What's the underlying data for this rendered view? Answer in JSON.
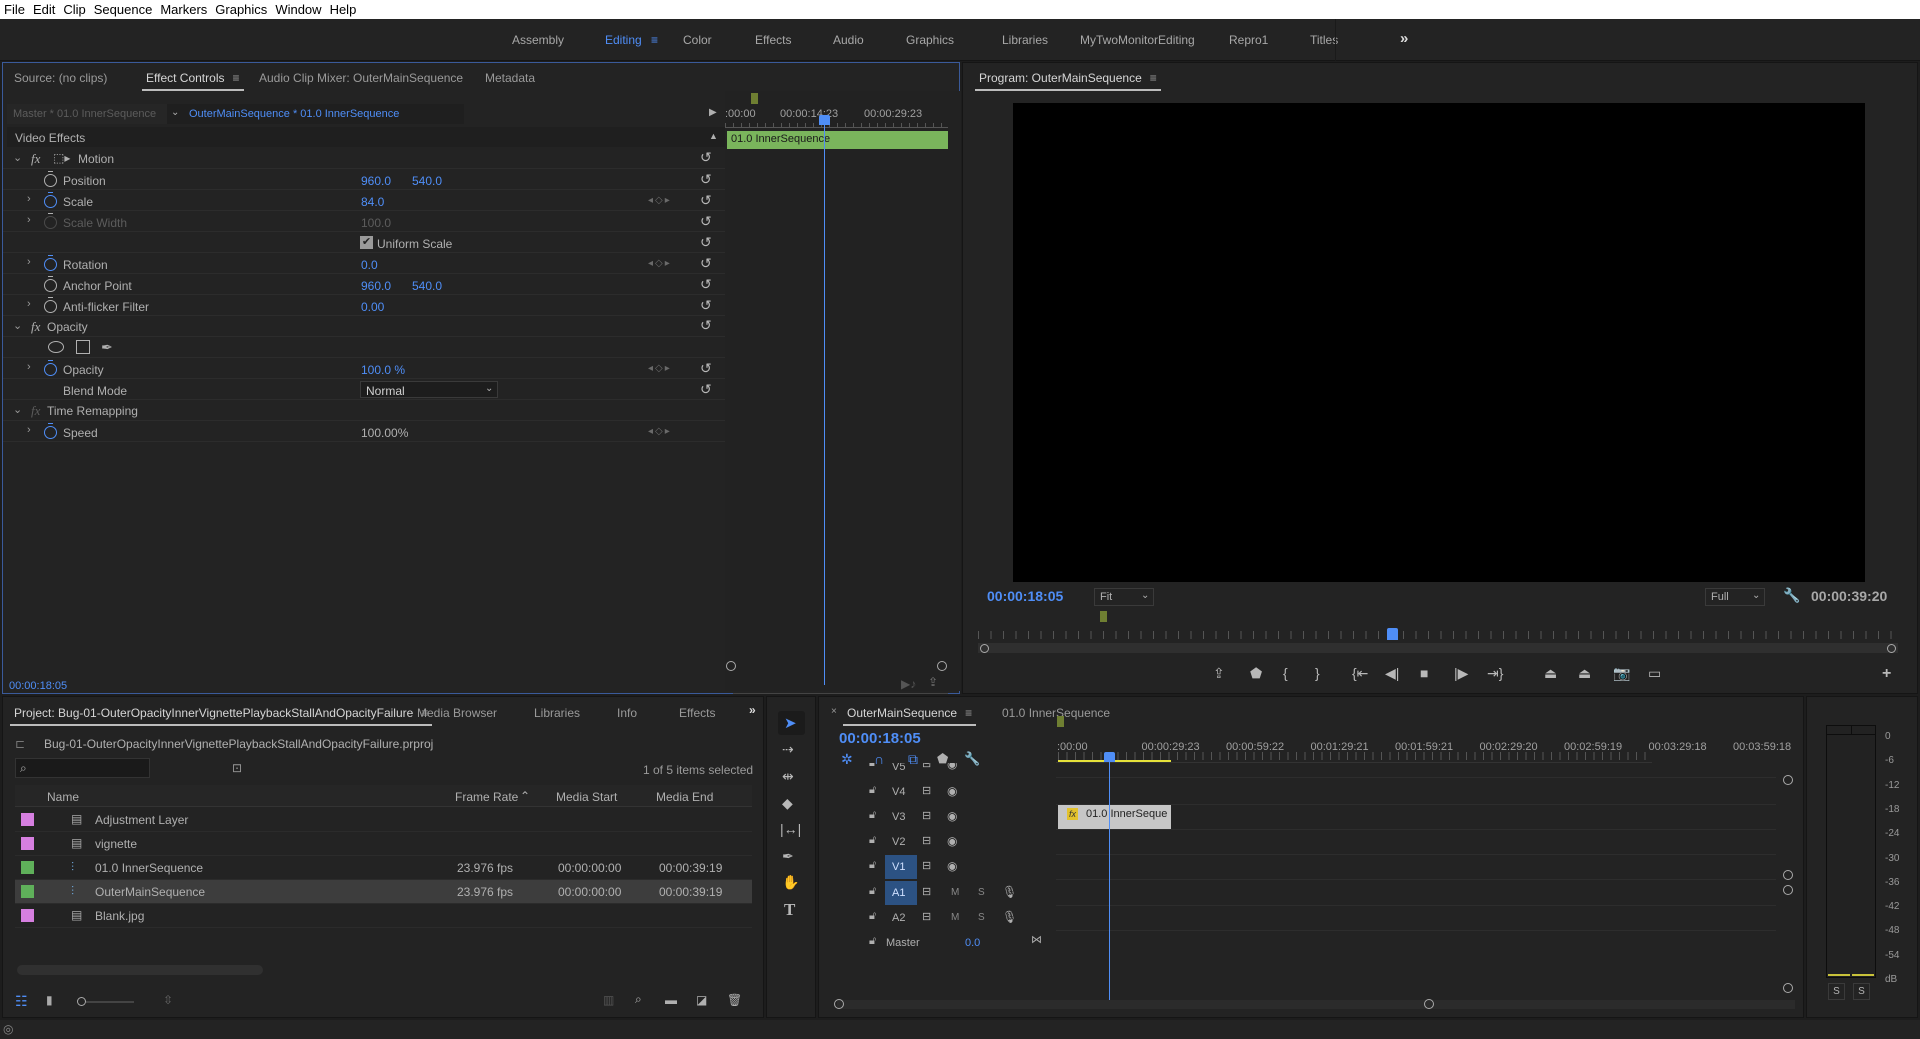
{
  "menu": [
    "File",
    "Edit",
    "Clip",
    "Sequence",
    "Markers",
    "Graphics",
    "Window",
    "Help"
  ],
  "workspaces": {
    "items": [
      "Assembly",
      "Editing",
      "Color",
      "Effects",
      "Audio",
      "Graphics",
      "Libraries",
      "MyTwoMonitorEditing",
      "Repro1",
      "Titles"
    ],
    "active": "Editing",
    "overflow": "»"
  },
  "source_panel": {
    "tabs": [
      "Source: (no clips)",
      "Effect Controls",
      "Audio Clip Mixer: OuterMainSequence",
      "Metadata"
    ],
    "active_tab": "Effect Controls",
    "master_label": "Master * 01.0 InnerSequence",
    "sequence_label": "OuterMainSequence * 01.0 InnerSequence",
    "section_title": "Video Effects",
    "motion": {
      "title": "Motion",
      "position": {
        "label": "Position",
        "x": "960.0",
        "y": "540.0"
      },
      "scale": {
        "label": "Scale",
        "value": "84.0"
      },
      "scale_width": {
        "label": "Scale Width",
        "value": "100.0"
      },
      "uniform_scale": {
        "label": "Uniform Scale",
        "checked": true
      },
      "rotation": {
        "label": "Rotation",
        "value": "0.0"
      },
      "anchor_point": {
        "label": "Anchor Point",
        "x": "960.0",
        "y": "540.0"
      },
      "anti_flicker": {
        "label": "Anti-flicker Filter",
        "value": "0.00"
      }
    },
    "opacity": {
      "title": "Opacity",
      "opacity": {
        "label": "Opacity",
        "value": "100.0 %"
      },
      "blend_mode": {
        "label": "Blend Mode",
        "value": "Normal"
      }
    },
    "time_remapping": {
      "title": "Time Remapping",
      "speed": {
        "label": "Speed",
        "value": "100.00%"
      }
    },
    "mini_timeline": {
      "ticks": [
        ":00:00",
        "00:00:14:23",
        "00:00:29:23"
      ],
      "clip_label": "01.0 InnerSequence"
    },
    "timecode": "00:00:18:05"
  },
  "program_monitor": {
    "title": "Program: OuterMainSequence",
    "timecode": "00:00:18:05",
    "zoom": "Fit",
    "resolution": "Full",
    "duration": "00:00:39:20",
    "playhead_fraction": 0.45
  },
  "project_panel": {
    "tabs": [
      "Project: Bug-01-OuterOpacityInnerVignettePlaybackStallAndOpacityFailure",
      "Media Browser",
      "Libraries",
      "Info",
      "Effects"
    ],
    "file_name": "Bug-01-OuterOpacityInnerVignettePlaybackStallAndOpacityFailure.prproj",
    "search_placeholder": "",
    "selection_status": "1 of 5 items selected",
    "columns": [
      "Name",
      "Frame Rate",
      "Media Start",
      "Media End"
    ],
    "rows": [
      {
        "name": "Adjustment Layer",
        "frame_rate": "",
        "media_start": "",
        "media_end": "",
        "color": "#d67fe0",
        "type": "file",
        "selected": false
      },
      {
        "name": "vignette",
        "frame_rate": "",
        "media_start": "",
        "media_end": "",
        "color": "#d67fe0",
        "type": "file",
        "selected": false
      },
      {
        "name": "01.0 InnerSequence",
        "frame_rate": "23.976 fps",
        "media_start": "00:00:00:00",
        "media_end": "00:00:39:19",
        "color": "#5fb05a",
        "type": "sequence",
        "selected": false
      },
      {
        "name": "OuterMainSequence",
        "frame_rate": "23.976 fps",
        "media_start": "00:00:00:00",
        "media_end": "00:00:39:19",
        "color": "#5fb05a",
        "type": "sequence",
        "selected": true
      },
      {
        "name": "Blank.jpg",
        "frame_rate": "",
        "media_start": "",
        "media_end": "",
        "color": "#d67fe0",
        "type": "file",
        "selected": false
      }
    ]
  },
  "timeline": {
    "tabs": [
      "OuterMainSequence",
      "01.0 InnerSequence"
    ],
    "active_tab": "OuterMainSequence",
    "timecode": "00:00:18:05",
    "ruler": [
      ":00:00",
      "00:00:29:23",
      "00:00:59:22",
      "00:01:29:21",
      "00:01:59:21",
      "00:02:29:20",
      "00:02:59:19",
      "00:03:29:18",
      "00:03:59:18"
    ],
    "video_tracks": [
      "V5",
      "V4",
      "V3",
      "V2",
      "V1"
    ],
    "audio_tracks": [
      "A1",
      "A2"
    ],
    "master_label": "Master",
    "master_value": "0.0",
    "clip_label": "01.0 InnerSeque",
    "mute_label": "M",
    "solo_label": "S"
  },
  "audio_meter": {
    "scale": [
      "0",
      "-6",
      "-12",
      "-18",
      "-24",
      "-30",
      "-36",
      "-42",
      "-48",
      "-54",
      "dB"
    ],
    "solo_buttons": [
      "S",
      "S"
    ]
  },
  "colors": {
    "accent": "#4f8ef7",
    "clip_green": "#7ab55c",
    "clip_gray": "#c6c6c6",
    "marker": "#6f7f32",
    "work_area": "#e6e23a"
  }
}
